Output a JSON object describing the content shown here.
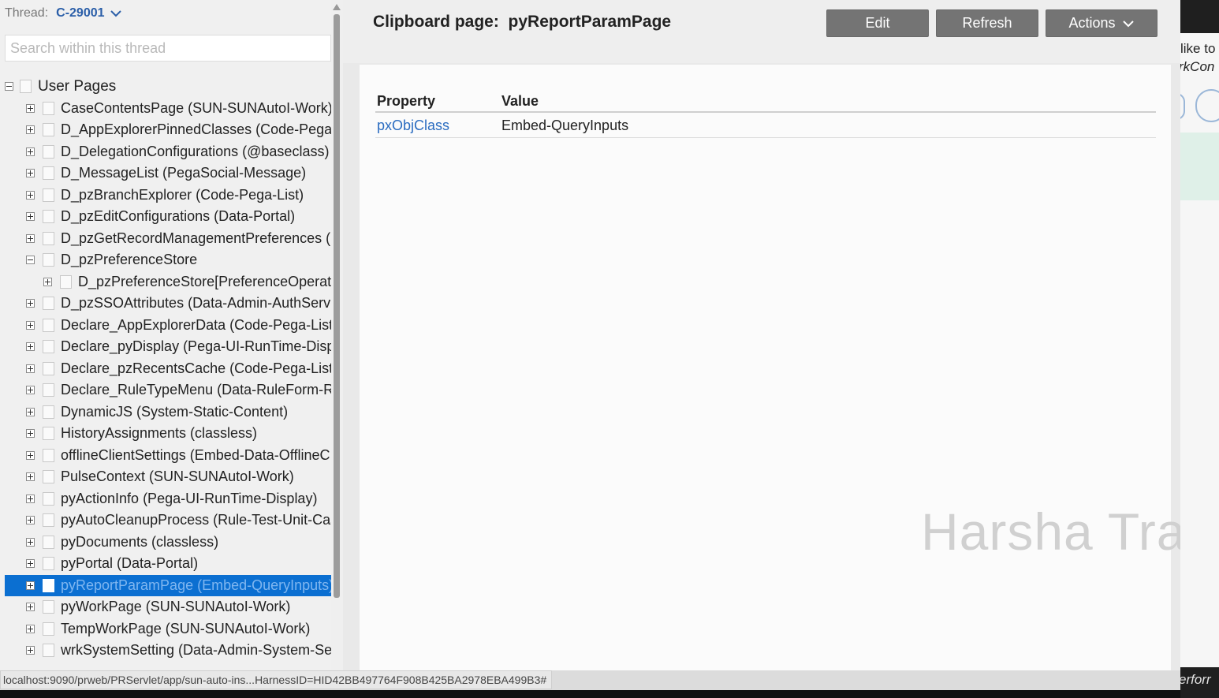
{
  "thread": {
    "label": "Thread:",
    "value": "C-29001"
  },
  "search": {
    "placeholder": "Search within this thread"
  },
  "tree": {
    "root": {
      "label": "User Pages",
      "expanded": true
    },
    "items": [
      {
        "label": "CaseContentsPage (SUN-SUNAutoI-Work)",
        "level": 1,
        "toggle": "plus"
      },
      {
        "label": "D_AppExplorerPinnedClasses (Code-Pega-List)",
        "level": 1,
        "toggle": "plus"
      },
      {
        "label": "D_DelegationConfigurations (@baseclass)",
        "level": 1,
        "toggle": "plus"
      },
      {
        "label": "D_MessageList (PegaSocial-Message)",
        "level": 1,
        "toggle": "plus"
      },
      {
        "label": "D_pzBranchExplorer (Code-Pega-List)",
        "level": 1,
        "toggle": "plus"
      },
      {
        "label": "D_pzEditConfigurations (Data-Portal)",
        "level": 1,
        "toggle": "plus"
      },
      {
        "label": "D_pzGetRecordManagementPreferences (D",
        "level": 1,
        "toggle": "plus"
      },
      {
        "label": "D_pzPreferenceStore",
        "level": 1,
        "toggle": "minus"
      },
      {
        "label": "D_pzPreferenceStore[PreferenceOperat",
        "level": 2,
        "toggle": "plus"
      },
      {
        "label": "D_pzSSOAttributes (Data-Admin-AuthServi",
        "level": 1,
        "toggle": "plus"
      },
      {
        "label": "Declare_AppExplorerData (Code-Pega-List)",
        "level": 1,
        "toggle": "plus"
      },
      {
        "label": "Declare_pyDisplay (Pega-UI-RunTime-Displ",
        "level": 1,
        "toggle": "plus"
      },
      {
        "label": "Declare_pzRecentsCache (Code-Pega-List)",
        "level": 1,
        "toggle": "plus"
      },
      {
        "label": "Declare_RuleTypeMenu (Data-RuleForm-Ru",
        "level": 1,
        "toggle": "plus"
      },
      {
        "label": "DynamicJS (System-Static-Content)",
        "level": 1,
        "toggle": "plus"
      },
      {
        "label": "HistoryAssignments (classless)",
        "level": 1,
        "toggle": "plus"
      },
      {
        "label": "offlineClientSettings (Embed-Data-OfflineC",
        "level": 1,
        "toggle": "plus"
      },
      {
        "label": "PulseContext (SUN-SUNAutoI-Work)",
        "level": 1,
        "toggle": "plus"
      },
      {
        "label": "pyActionInfo (Pega-UI-RunTime-Display)",
        "level": 1,
        "toggle": "plus"
      },
      {
        "label": "pyAutoCleanupProcess (Rule-Test-Unit-Cas",
        "level": 1,
        "toggle": "plus"
      },
      {
        "label": "pyDocuments (classless)",
        "level": 1,
        "toggle": "plus"
      },
      {
        "label": "pyPortal (Data-Portal)",
        "level": 1,
        "toggle": "plus"
      },
      {
        "label": "pyReportParamPage (Embed-QueryInputs)",
        "level": 1,
        "toggle": "plus",
        "selected": true
      },
      {
        "label": "pyWorkPage (SUN-SUNAutoI-Work)",
        "level": 1,
        "toggle": "plus"
      },
      {
        "label": "TempWorkPage (SUN-SUNAutoI-Work)",
        "level": 1,
        "toggle": "plus"
      },
      {
        "label": "wrkSystemSetting (Data-Admin-System-Se",
        "level": 1,
        "toggle": "plus"
      }
    ]
  },
  "header": {
    "title_prefix": "Clipboard page:",
    "title_page": "pyReportParamPage",
    "edit_label": "Edit",
    "refresh_label": "Refresh",
    "actions_label": "Actions"
  },
  "table": {
    "columns": [
      "Property",
      "Value"
    ],
    "rows": [
      {
        "property": "pxObjClass",
        "value": "Embed-QueryInputs"
      }
    ]
  },
  "watermark": "Harsha Train",
  "background_window": {
    "text1": "like to",
    "text2": "rkCon",
    "bottom_text": "erforr"
  },
  "status_bar": {
    "url": "localhost:9090/prweb/PRServlet/app/sun-auto-ins...HarnessID=HID42BB497764F908B425BA2978EBA499B3#"
  },
  "colors": {
    "accent": "#2a5ea8",
    "selected": "#0b6fd1",
    "button": "#747474",
    "link": "#2a6cc0"
  }
}
